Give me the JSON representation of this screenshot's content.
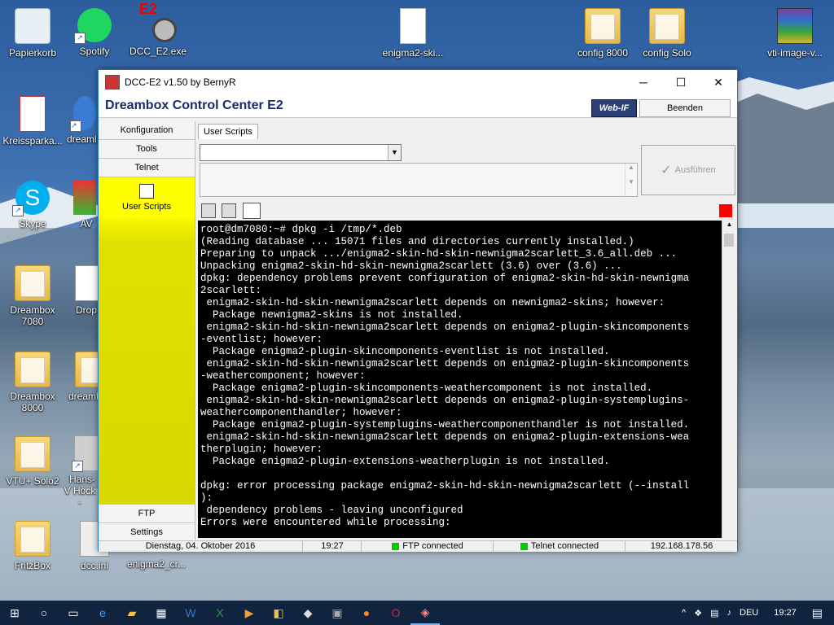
{
  "desktop": {
    "icons": [
      {
        "label": "Papierkorb"
      },
      {
        "label": "Spotify"
      },
      {
        "label": "DCC_E2.exe"
      },
      {
        "label": "enigma2-ski..."
      },
      {
        "label": "config 8000"
      },
      {
        "label": "config Solo"
      },
      {
        "label": "vti-image-v..."
      },
      {
        "label": "Kreissparka..."
      },
      {
        "label": "dreaml"
      },
      {
        "label": "Skype"
      },
      {
        "label": "AV"
      },
      {
        "label": "Dreambox 7080"
      },
      {
        "label": "Drop"
      },
      {
        "label": "Dreambox 8000"
      },
      {
        "label": "dreaml"
      },
      {
        "label": "VTU+ Solo2"
      },
      {
        "label": "Hans-V Hock -"
      },
      {
        "label": "FritzBox"
      },
      {
        "label": "dcc.ini"
      },
      {
        "label": "enigma2_cr..."
      }
    ],
    "e2_badge": "E2"
  },
  "window": {
    "title": "DCC-E2 v1.50 by BernyR",
    "minimize": "─",
    "maximize": "☐",
    "close": "✕",
    "app_title": "Dreambox Control Center E2",
    "webif_label": "Web-IF",
    "beenden_label": "Beenden"
  },
  "sidebar": {
    "top_items": [
      "Konfiguration",
      "Tools",
      "Telnet"
    ],
    "active_item": "User Scripts",
    "bottom_items": [
      "FTP",
      "Settings"
    ]
  },
  "main": {
    "tab_label": "User Scripts",
    "script_select_value": "",
    "run_button": "Ausführen"
  },
  "terminal": {
    "lines": [
      "root@dm7080:~# dpkg -i /tmp/*.deb",
      "(Reading database ... 15071 files and directories currently installed.)",
      "Preparing to unpack .../enigma2-skin-hd-skin-newnigma2scarlett_3.6_all.deb ...",
      "Unpacking enigma2-skin-hd-skin-newnigma2scarlett (3.6) over (3.6) ...",
      "dpkg: dependency problems prevent configuration of enigma2-skin-hd-skin-newnigma",
      "2scarlett:",
      " enigma2-skin-hd-skin-newnigma2scarlett depends on newnigma2-skins; however:",
      "  Package newnigma2-skins is not installed.",
      " enigma2-skin-hd-skin-newnigma2scarlett depends on enigma2-plugin-skincomponents",
      "-eventlist; however:",
      "  Package enigma2-plugin-skincomponents-eventlist is not installed.",
      " enigma2-skin-hd-skin-newnigma2scarlett depends on enigma2-plugin-skincomponents",
      "-weathercomponent; however:",
      "  Package enigma2-plugin-skincomponents-weathercomponent is not installed.",
      " enigma2-skin-hd-skin-newnigma2scarlett depends on enigma2-plugin-systemplugins-",
      "weathercomponenthandler; however:",
      "  Package enigma2-plugin-systemplugins-weathercomponenthandler is not installed.",
      " enigma2-skin-hd-skin-newnigma2scarlett depends on enigma2-plugin-extensions-wea",
      "therplugin; however:",
      "  Package enigma2-plugin-extensions-weatherplugin is not installed.",
      "",
      "dpkg: error processing package enigma2-skin-hd-skin-newnigma2scarlett (--install",
      "):",
      " dependency problems - leaving unconfigured",
      "Errors were encountered while processing:"
    ]
  },
  "statusbar": {
    "date": "Dienstag, 04. Oktober 2016",
    "time": "19:27",
    "ftp_status": "FTP connected",
    "telnet_status": "Telnet connected",
    "ip": "192.168.178.56"
  },
  "taskbar": {
    "lang": "DEU",
    "clock": "19:27"
  }
}
